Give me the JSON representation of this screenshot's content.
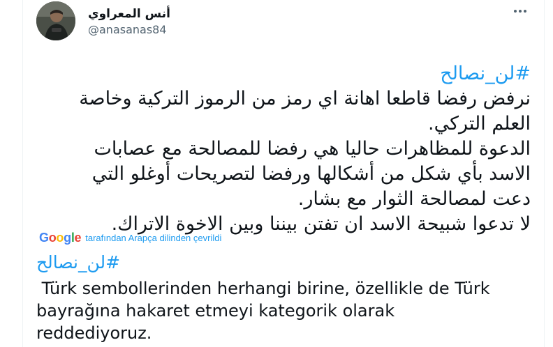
{
  "author": {
    "name": "أنس المعراوي",
    "handle": "@anasanas84"
  },
  "tweet": {
    "hashtag": "#لن_نصالح",
    "lines": [
      "نرفض رفضا قاطعا اهانة اي رمز من الرموز التركية وخاصة",
      "العلم التركي.",
      "الدعوة للمظاهرات حاليا هي رفضا للمصالحة مع عصابات",
      "الاسد بأي شكل من أشكالها ورفضا لتصريحات أوغلو التي",
      "دعت لمصالحة الثوار مع بشار.",
      "لا تدعوا شبيحة الاسد ان تفتن بيننا وبين الاخوة الاتراك."
    ]
  },
  "translation": {
    "google_letters": [
      "G",
      "o",
      "o",
      "g",
      "l",
      "e"
    ],
    "google_colors": [
      "#4285f4",
      "#ea4335",
      "#fbbc05",
      "#4285f4",
      "#34a853",
      "#ea4335"
    ],
    "label": "tarafından Arapça dilinden çevrildi",
    "hashtag": "#لن_نصالح",
    "text": " Türk sembollerinden herhangi birine, özellikle de Türk\nbayrağına hakaret etmeyi kategorik olarak\nreddediyoruz."
  },
  "icons": {
    "more": "more-dots-icon",
    "avatar": "avatar-photo"
  },
  "colors": {
    "link": "#1d9bf0",
    "text": "#0f1419",
    "secondary": "#536471"
  }
}
